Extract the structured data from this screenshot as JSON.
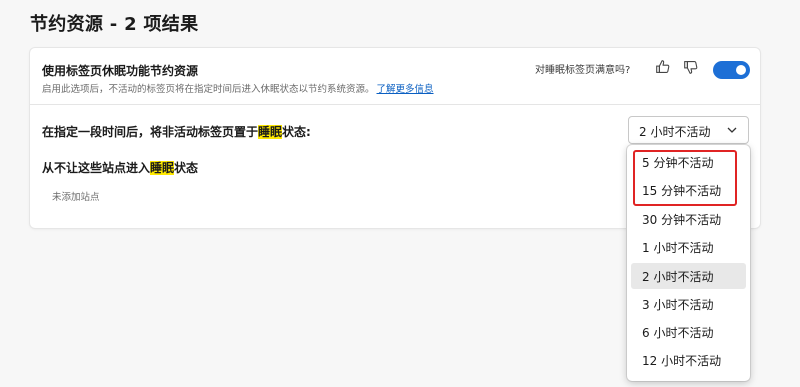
{
  "page": {
    "title": "节约资源 - 2 项结果"
  },
  "sleeping_tabs": {
    "title": "使用标签页休眠功能节约资源",
    "description": "启用此选项后，不活动的标签页将在指定时间后进入休眠状态以节约系统资源。",
    "learn_more": "了解更多信息",
    "feedback_label": "对睡眠标签页满意吗?",
    "toggle_on": true,
    "accent_color": "#1d6fd6"
  },
  "sleep_after": {
    "label_before": "在指定一段时间后，将非活动标签页置于",
    "label_highlight": "睡眠",
    "label_after": "状态:",
    "selected_value": "2 小时不活动"
  },
  "never_sleep": {
    "label_before": "从不让这些站点进入",
    "label_highlight": "睡眠",
    "label_after": "状态",
    "empty_text": "未添加站点"
  },
  "dropdown": {
    "options": [
      "5 分钟不活动",
      "15 分钟不活动",
      "30 分钟不活动",
      "1 小时不活动",
      "2 小时不活动",
      "3 小时不活动",
      "6 小时不活动",
      "12 小时不活动"
    ],
    "selected_index": 4,
    "outlined_color": "#e02424"
  },
  "icons": [
    "thumbs-up-icon",
    "thumbs-down-icon",
    "chevron-down-icon"
  ]
}
